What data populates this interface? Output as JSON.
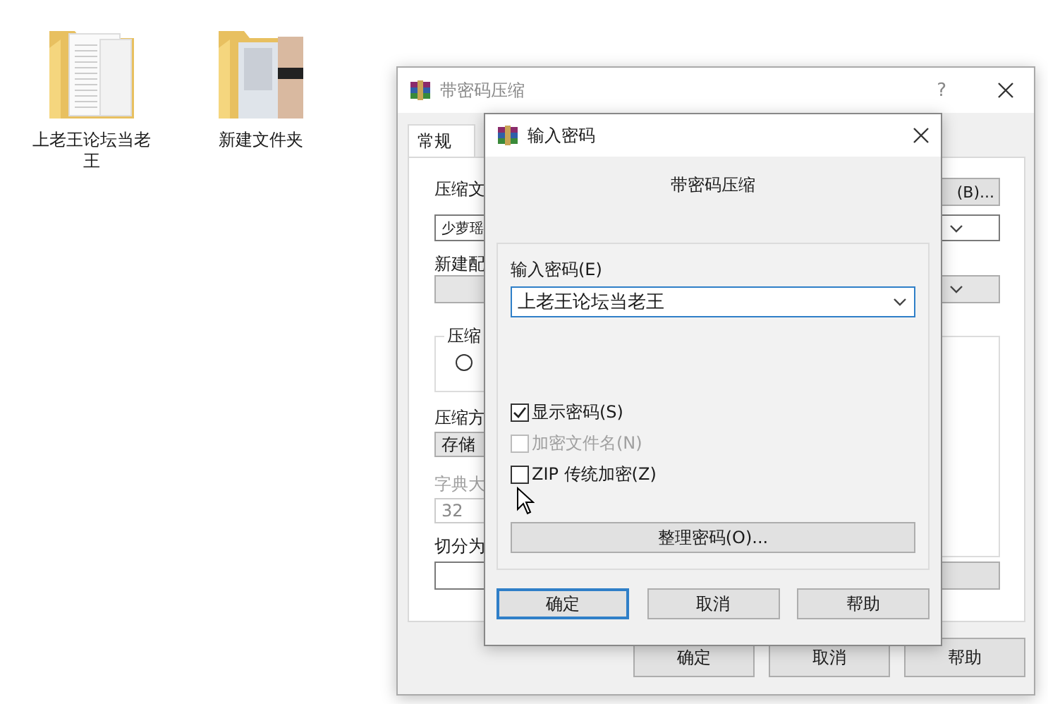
{
  "desktop_icons": [
    {
      "label": "上老王论坛当老王",
      "kind": "documents"
    },
    {
      "label": "新建文件夹",
      "kind": "photos"
    }
  ],
  "back_window": {
    "title": "带密码压缩",
    "help_glyph": "?",
    "tabs": [
      {
        "label": "常规",
        "selected": true
      }
    ],
    "archive_name": {
      "label": "压缩文",
      "value": "少萝瑶",
      "browse_button": "(B)..."
    },
    "profile": {
      "label": "新建配"
    },
    "format_group": {
      "label": "压缩",
      "radio_selected": false
    },
    "method": {
      "label": "压缩方",
      "value": "存储"
    },
    "dictionary": {
      "label": "字典大",
      "value": "32",
      "disabled": true
    },
    "split": {
      "label": "切分为"
    },
    "buttons": [
      "确定",
      "取消",
      "帮助"
    ]
  },
  "dialog": {
    "title": "输入密码",
    "heading": "带密码压缩",
    "password_label": "输入密码(E)",
    "password_value": "上老王论坛当老王",
    "options": [
      {
        "label": "显示密码(S)",
        "checked": true,
        "disabled": false
      },
      {
        "label": "加密文件名(N)",
        "checked": false,
        "disabled": true
      },
      {
        "label": "ZIP 传统加密(Z)",
        "checked": false,
        "disabled": false
      }
    ],
    "manage_button": "整理密码(O)...",
    "buttons": [
      {
        "label": "确定",
        "default": true
      },
      {
        "label": "取消",
        "default": false
      },
      {
        "label": "帮助",
        "default": false
      }
    ]
  }
}
